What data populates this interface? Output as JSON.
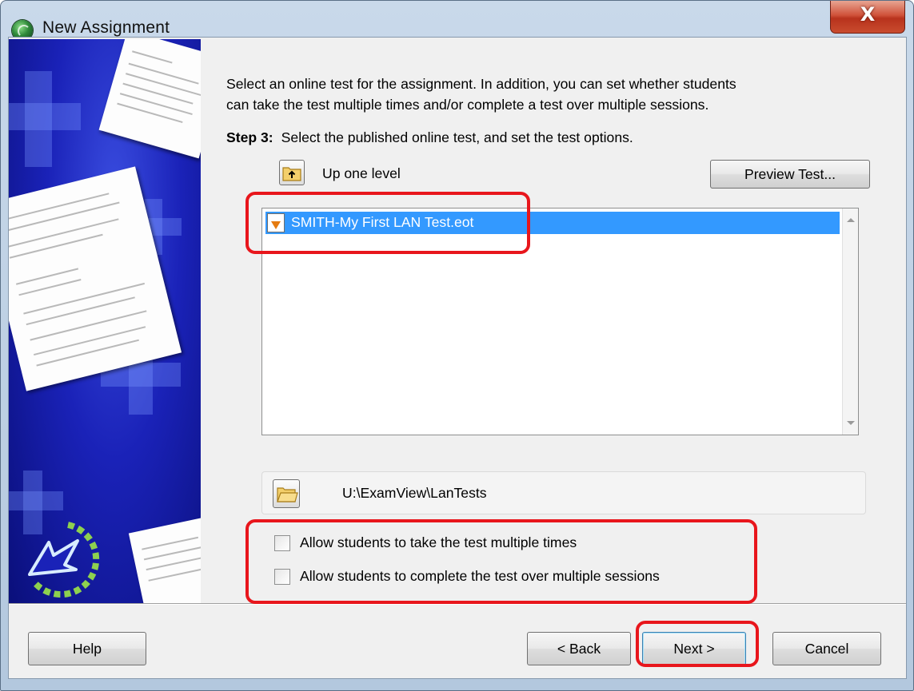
{
  "window": {
    "title": "New Assignment",
    "close_glyph": "X"
  },
  "content": {
    "intro_line1": "Select an online test for the assignment.  In addition, you can set whether students",
    "intro_line2": "can take the test multiple times and/or complete a test over multiple sessions.",
    "step_label": "Step 3:",
    "step_text": "Select the published online test, and set the test options.",
    "up_one_level": "Up one level",
    "preview_button": "Preview Test...",
    "files": [
      {
        "name": "SMITH-My First LAN Test.eot",
        "selected": true
      }
    ],
    "current_path": "U:\\ExamView\\LanTests",
    "options": [
      {
        "label": "Allow students to take the test multiple times",
        "checked": false
      },
      {
        "label": "Allow students to complete the test over multiple sessions",
        "checked": false
      }
    ]
  },
  "footer": {
    "help": "Help",
    "back": "< Back",
    "next": "Next >",
    "cancel": "Cancel"
  },
  "icons": {
    "app": "globe-icon",
    "up": "folder-up-icon",
    "file": "online-test-file-icon",
    "folder": "folder-icon"
  },
  "colors": {
    "selection": "#3399ff",
    "highlight": "#e8161c",
    "banner": "#1a22b8"
  }
}
